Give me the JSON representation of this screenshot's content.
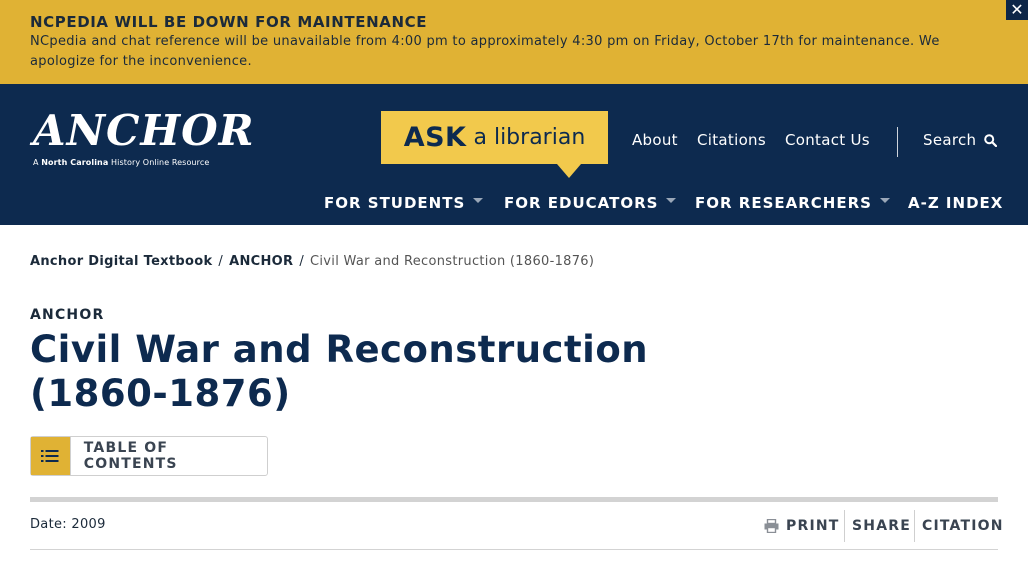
{
  "alert": {
    "title": "NCPEDIA WILL BE DOWN FOR MAINTENANCE",
    "body": "NCpedia and chat reference will be unavailable from 4:00 pm to approximately 4:30 pm on Friday, October 17th for maintenance. We apologize for the inconvenience.",
    "close_icon": "close-icon",
    "close_glyph": "✕"
  },
  "header": {
    "logo_word": "ANCHOR",
    "logo_subtitle_lead": "A ",
    "logo_subtitle_bold": "North Carolina",
    "logo_subtitle_tail": " History Online Resource",
    "ask_big": "ASK",
    "ask_small": "a librarian",
    "utility_links": [
      "About",
      "Citations",
      "Contact Us"
    ],
    "search_label": "Search",
    "search_icon": "search-icon",
    "nav": [
      {
        "label": "FOR STUDENTS",
        "has_caret": true
      },
      {
        "label": "FOR EDUCATORS",
        "has_caret": true
      },
      {
        "label": "FOR RESEARCHERS",
        "has_caret": true
      },
      {
        "label": "A-Z INDEX",
        "has_caret": false
      }
    ]
  },
  "breadcrumb": {
    "items": [
      "Anchor Digital Textbook",
      "ANCHOR"
    ],
    "separator": "/",
    "current": "Civil War and Reconstruction (1860-1876)"
  },
  "page": {
    "eyebrow": "ANCHOR",
    "title": "Civil War and Reconstruction (1860-1876)",
    "toc_label": "TABLE OF CONTENTS",
    "toc_icon": "list-icon",
    "date": "Date: 2009",
    "tools": {
      "print": "PRINT",
      "print_icon": "printer-icon",
      "share": "SHARE",
      "citation": "CITATION"
    }
  },
  "colors": {
    "alert_bg": "#e0b234",
    "header_bg": "#0d2a4f",
    "ask_bg": "#f2c94c",
    "title_color": "#0d2a4f"
  }
}
